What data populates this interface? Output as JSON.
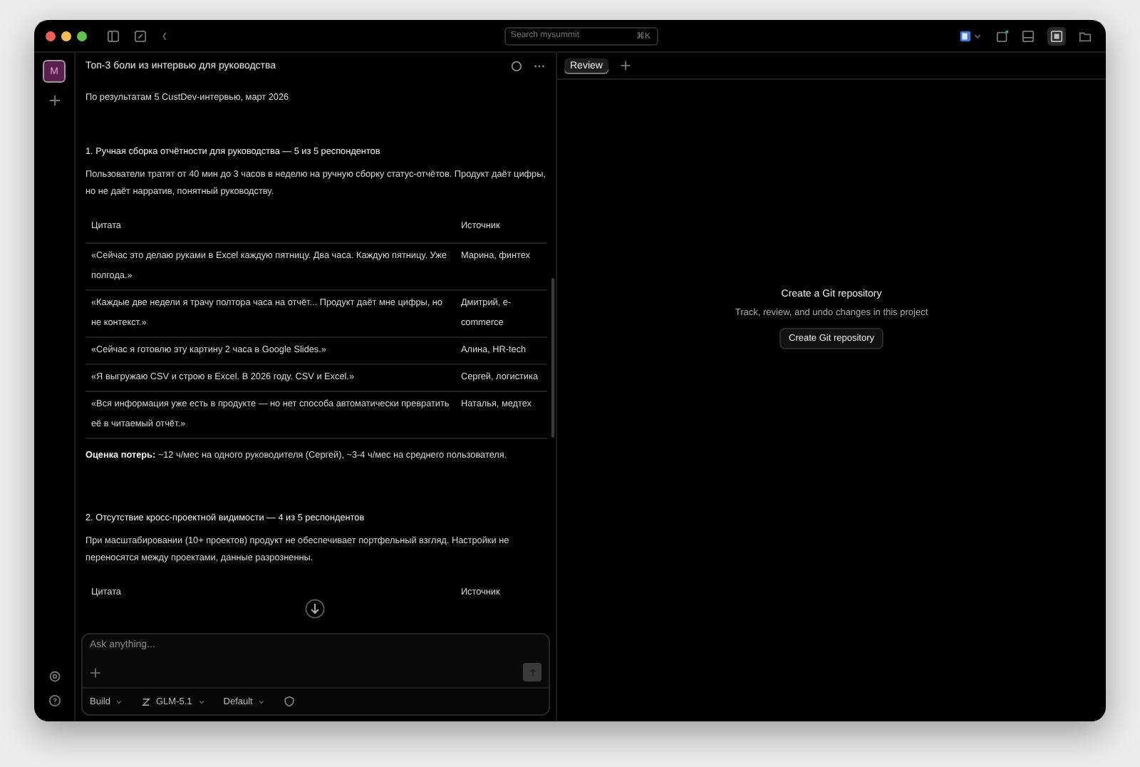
{
  "window": {
    "search": {
      "placeholder": "Search mysummit",
      "shortcut": "⌘K"
    }
  },
  "rail": {
    "avatar": "M"
  },
  "chat": {
    "title": "Топ-3 боли из интервью для руководства",
    "blocks": [
      {
        "kind": "paragraph",
        "text": "По результатам 5 CustDev-интервью, март 2026"
      },
      {
        "kind": "heading",
        "text": "1. Ручная сборка отчётности для руководства — 5 из 5 респондентов"
      },
      {
        "kind": "paragraph",
        "text": "Пользователи тратят от 40 мин до 3 часов в неделю на ручную сборку статус-отчётов. Продукт даёт цифры, но не даёт нарратив, понятный руководству."
      },
      {
        "kind": "table",
        "columns": [
          "Цитата",
          "Источник"
        ],
        "rows": [
          [
            "«Сейчас это делаю руками в Excel каждую пятницу. Два часа. Каждую пятницу. Уже полгода.»",
            "Марина, финтех"
          ],
          [
            "«Каждые две недели я трачу полтора часа на отчёт... Продукт даёт мне цифры, но не контекст.»",
            "Дмитрий, e-commerce"
          ],
          [
            "«Сейчас я готовлю эту картину 2 часа в Google Slides.»",
            "Алина, HR-tech"
          ],
          [
            "«Я выгружаю CSV и строю в Excel. В 2026 году. CSV и Excel.»",
            "Сергей, логистика"
          ],
          [
            "«Вся информация уже есть в продукте — но нет способа автоматически превратить её в читаемый отчёт.»",
            "Наталья, медтех"
          ]
        ]
      },
      {
        "kind": "paragraph",
        "text": "**Оценка потерь:** ~12 ч/мес на одного руководителя (Сергей), ~3-4 ч/мес на среднего пользователя."
      },
      {
        "kind": "heading",
        "text": "2. Отсутствие кросс-проектной видимости — 4 из 5 респондентов"
      },
      {
        "kind": "paragraph",
        "text": "При масштабировании (10+ проектов) продукт не обеспечивает портфельный взгляд. Настройки не переносятся между проектами, данные разрозненны."
      },
      {
        "kind": "table",
        "columns": [
          "Цитата",
          "Источник"
        ]
      }
    ]
  },
  "composer": {
    "placeholder": "Ask anything...",
    "options": [
      {
        "kind": "mode",
        "label": "Build"
      },
      {
        "kind": "model",
        "label": "GLM-5.1"
      },
      {
        "kind": "mode",
        "label": "Default"
      }
    ]
  },
  "review": {
    "tabs": [
      {
        "label": "Review",
        "selected": true
      }
    ],
    "empty": {
      "title": "Create a Git repository",
      "text": "Track, review, and undo changes in this project",
      "button": "Create Git repository"
    }
  }
}
